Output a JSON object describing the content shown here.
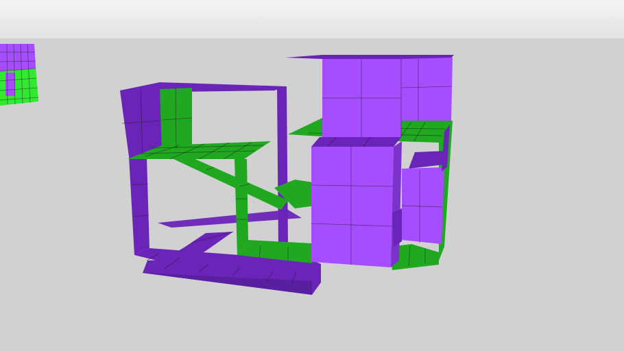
{
  "viewport": {
    "sky_color_top": "#f4f4f4",
    "sky_color_bottom": "#e3e3e3",
    "ground_color": "#d1d1d1",
    "horizon_line_color": "#c8c8c8"
  },
  "model": {
    "purple_color": "#a64dff",
    "purple_shade_color": "#6a25b8",
    "green_color": "#21a821",
    "green_bright_color": "#33e833"
  },
  "thumbnail": {
    "present": true
  }
}
